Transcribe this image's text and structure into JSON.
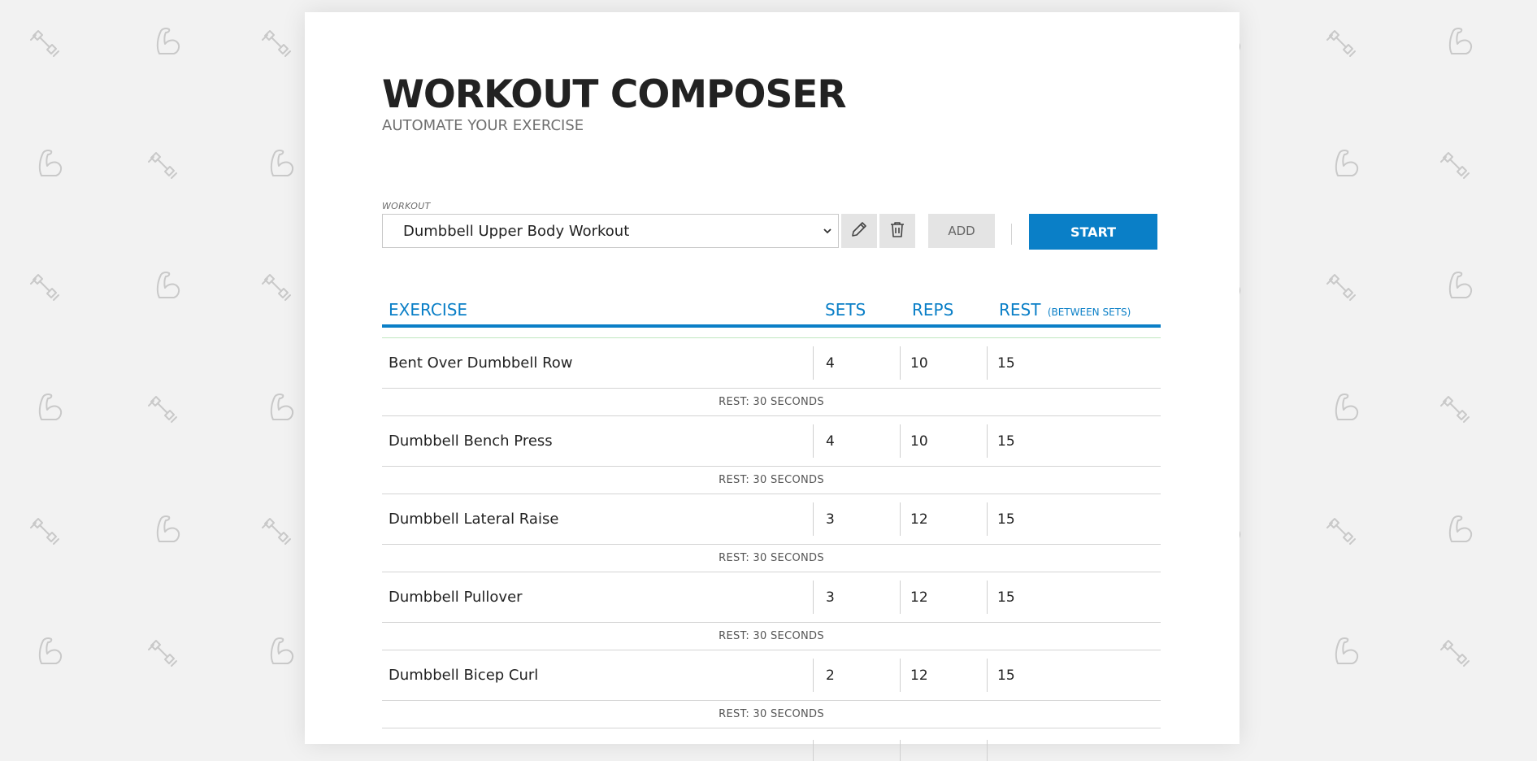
{
  "app": {
    "title": "WORKOUT COMPOSER",
    "subtitle": "AUTOMATE YOUR EXERCISE"
  },
  "workout_select": {
    "label": "WORKOUT",
    "selected": "Dumbbell Upper Body Workout"
  },
  "buttons": {
    "add": "ADD",
    "start": "START"
  },
  "icons": {
    "edit": "pencil-icon",
    "delete": "trash-icon",
    "dropdown": "chevron-down-icon",
    "background_a": "dumbbell-icon",
    "background_b": "flexed-bicep-icon"
  },
  "table": {
    "headers": {
      "exercise": "EXERCISE",
      "sets": "SETS",
      "reps": "REPS",
      "rest": "REST",
      "rest_sub": "(BETWEEN SETS)"
    },
    "rows": [
      {
        "name": "Bent Over Dumbbell Row",
        "sets": "4",
        "reps": "10",
        "rest": "15",
        "rest_after": "REST: 30 SECONDS"
      },
      {
        "name": "Dumbbell Bench Press",
        "sets": "4",
        "reps": "10",
        "rest": "15",
        "rest_after": "REST: 30 SECONDS"
      },
      {
        "name": "Dumbbell Lateral Raise",
        "sets": "3",
        "reps": "12",
        "rest": "15",
        "rest_after": "REST: 30 SECONDS"
      },
      {
        "name": "Dumbbell Pullover",
        "sets": "3",
        "reps": "12",
        "rest": "15",
        "rest_after": "REST: 30 SECONDS"
      },
      {
        "name": "Dumbbell Bicep Curl",
        "sets": "2",
        "reps": "12",
        "rest": "15",
        "rest_after": "REST: 30 SECONDS"
      }
    ]
  },
  "colors": {
    "accent": "#0a7fc7",
    "background": "#f2f2f2",
    "card": "#ffffff",
    "button_gray": "#e4e4e4",
    "text_dark": "#222222"
  }
}
